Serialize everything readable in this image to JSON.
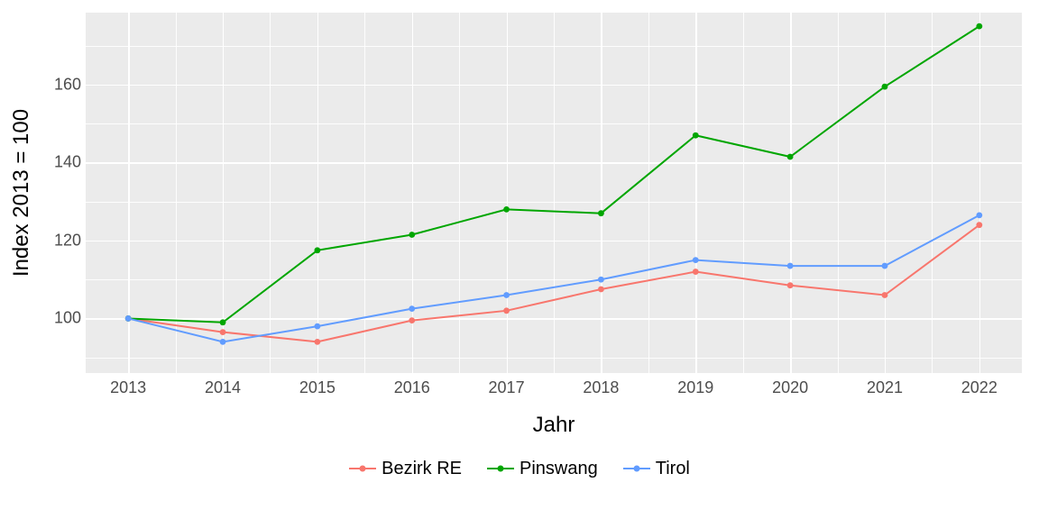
{
  "chart_data": {
    "type": "line",
    "xlabel": "Jahr",
    "ylabel": "Index  2013  =  100",
    "categories": [
      2013,
      2014,
      2015,
      2016,
      2017,
      2018,
      2019,
      2020,
      2021,
      2022
    ],
    "x_ticks": [
      2013,
      2014,
      2015,
      2016,
      2017,
      2018,
      2019,
      2020,
      2021,
      2022
    ],
    "y_ticks": [
      100,
      120,
      140,
      160
    ],
    "y_minor": [
      90,
      110,
      130,
      150,
      170
    ],
    "ylim": [
      86,
      178.5
    ],
    "xlim": [
      2012.55,
      2022.45
    ],
    "series": [
      {
        "name": "Bezirk RE",
        "color": "#F8766D",
        "values": [
          100,
          96.5,
          94,
          99.5,
          102,
          107.5,
          112,
          108.5,
          106,
          124
        ]
      },
      {
        "name": "Pinswang",
        "color": "#00A600",
        "values": [
          100,
          99,
          117.5,
          121.5,
          128,
          127,
          147,
          141.5,
          159.5,
          175
        ]
      },
      {
        "name": "Tirol",
        "color": "#619CFF",
        "values": [
          100,
          94,
          98,
          102.5,
          106,
          110,
          115,
          113.5,
          113.5,
          126.5
        ]
      }
    ],
    "legend_position": "bottom"
  }
}
